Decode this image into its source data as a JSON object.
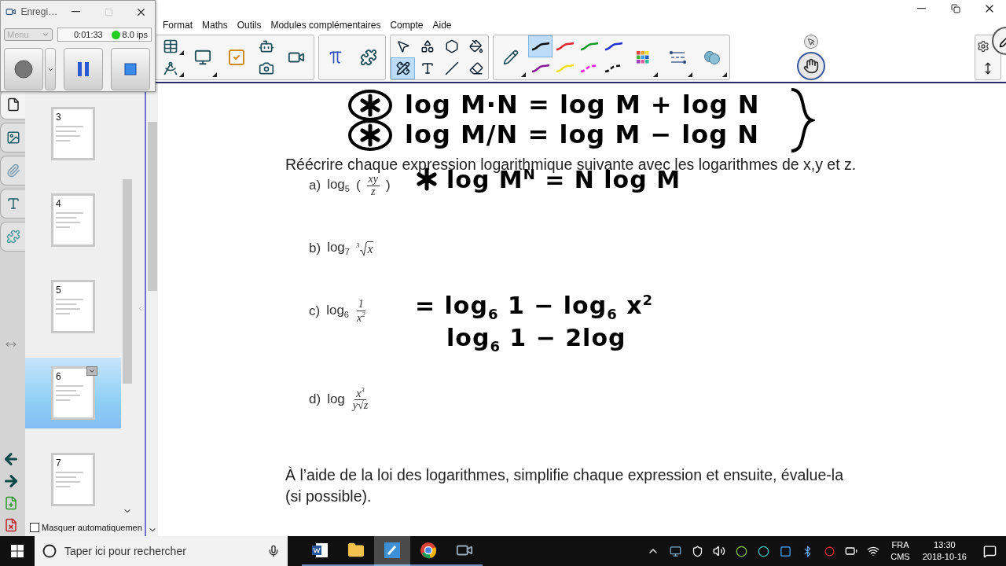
{
  "recorder": {
    "title": "Enregi…",
    "menu": "Menu",
    "time": "0:01:33",
    "rate": "8.0 ips",
    "recording": true
  },
  "menu": [
    "Format",
    "Maths",
    "Outils",
    "Modules complémentaires",
    "Compte",
    "Aide"
  ],
  "tools": [
    {
      "kind": "select",
      "selected": false
    },
    {
      "kind": "shape",
      "selected": false
    },
    {
      "kind": "polygon",
      "selected": false
    },
    {
      "kind": "fill",
      "selected": false
    },
    {
      "kind": "pens",
      "selected": true
    },
    {
      "kind": "text",
      "selected": false
    },
    {
      "kind": "line",
      "selected": false
    },
    {
      "kind": "eraser",
      "selected": false
    }
  ],
  "pens": [
    {
      "color": "#111111",
      "kind": "solid",
      "selected": true
    },
    {
      "color": "#e0242b",
      "kind": "solid",
      "selected": false
    },
    {
      "color": "#1a9a2a",
      "kind": "solid",
      "selected": false
    },
    {
      "color": "#1f2fd0",
      "kind": "solid",
      "selected": false
    },
    {
      "color": "#8a1a9a",
      "kind": "solid",
      "selected": false
    },
    {
      "color": "#f0e020",
      "kind": "solid",
      "selected": false
    },
    {
      "color": "#f020e0",
      "kind": "dashed",
      "selected": false
    },
    {
      "color": "#111111",
      "kind": "dashed",
      "selected": false
    }
  ],
  "sidebar": {
    "pages": [
      {
        "number": "3",
        "selected": false
      },
      {
        "number": "4",
        "selected": false
      },
      {
        "number": "5",
        "selected": false
      },
      {
        "number": "6",
        "selected": true
      },
      {
        "number": "7",
        "selected": false
      }
    ],
    "autohide": {
      "label": "Masquer automatiquemen",
      "checked": false
    }
  },
  "document": {
    "ink_top": [
      {
        "text": "log M·N = log M + log N",
        "circled": true
      },
      {
        "text": "log M/N = log M − log N",
        "circled": true
      }
    ],
    "instruction": "Réécrire chaque expression logarithmique suivante avec les logarithmes de x,y et z.",
    "items": [
      {
        "label": "a)",
        "func": "log$_{5}$",
        "kind": "fraction",
        "open": "(",
        "num": "xy",
        "den": "z",
        "close": ")",
        "starred": true,
        "ink": [
          "log M$^{N}$ = N log M"
        ]
      },
      {
        "label": "b)",
        "func": "log$_{7}$",
        "kind": "root",
        "index": "3",
        "radicand": "x",
        "starred": false
      },
      {
        "label": "c)",
        "func": "log$_{6}$",
        "kind": "fraction",
        "num": "1",
        "den": "x$^{2}$",
        "starred": false,
        "ink": [
          "= log$_{6}$ 1 − log$_{6}$ x$^{2}$",
          "log$_{6}$ 1 − 2log"
        ]
      },
      {
        "label": "d)",
        "func": "log",
        "kind": "fraction",
        "num": "x$^{3}$",
        "den": "y√z",
        "starred": false
      }
    ],
    "paragraph": "À l’aide de la loi des logarithmes, simplifie chaque expression et ensuite, évalue-la (si possible)."
  },
  "taskbar": {
    "search": {
      "placeholder": "Taper ici pour rechercher"
    },
    "apps": [
      {
        "kind": "word",
        "active": false
      },
      {
        "kind": "folder",
        "active": false
      },
      {
        "kind": "notebook",
        "active": true
      },
      {
        "kind": "browser",
        "active": false
      },
      {
        "kind": "recorder",
        "active": false
      }
    ],
    "language": "FRA",
    "layout": "CMS",
    "time": "13:30",
    "date": "2018-10-16"
  }
}
